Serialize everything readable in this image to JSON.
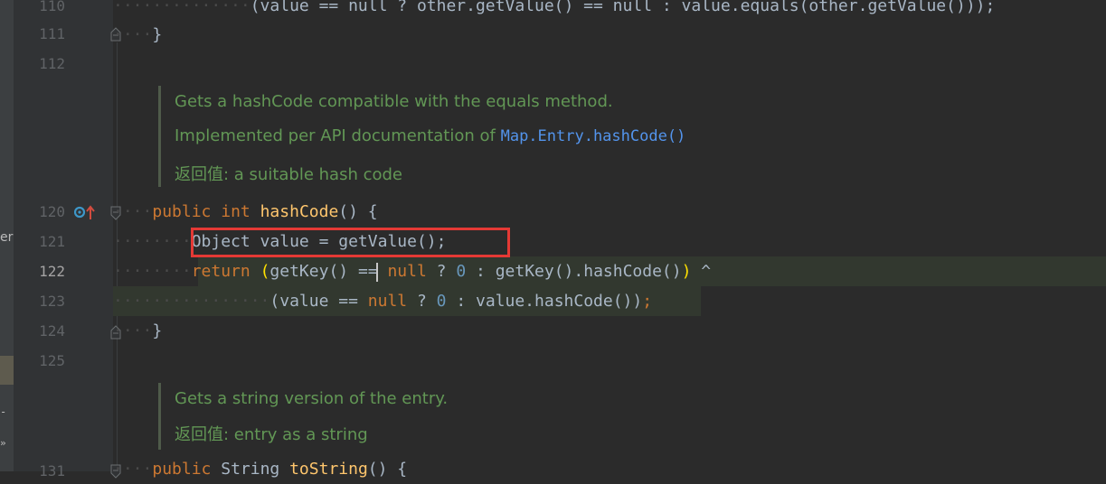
{
  "gutter": {
    "line_numbers": [
      "110",
      "111",
      "112",
      "120",
      "121",
      "122",
      "123",
      "124",
      "125",
      "131"
    ],
    "current_line": "122"
  },
  "side_panel": {
    "label_fragment": "er",
    "expand_glyph": "»"
  },
  "code": {
    "l110": {
      "indent": "··············",
      "text": "(value == null ? other.getValue() == null : value.equals(other.getValue()));"
    },
    "l111": {
      "indent": "····",
      "text": "}"
    },
    "l120": {
      "indent": "····",
      "kw1": "public",
      "kw2": "int",
      "fn": "hashCode",
      "rest": "() {"
    },
    "l121": {
      "indent": "········",
      "text": "Object value = getValue();"
    },
    "l122": {
      "indent": "········",
      "kw": "return",
      "open": "(",
      "p1": "getKey() == ",
      "null": "null",
      "p2": " ? ",
      "zero": "0",
      "p3": " : getKey().hashCode()",
      "close": ")",
      "op": " ^"
    },
    "l123": {
      "indent": "················",
      "p1": "(value == ",
      "null": "null",
      "p2": " ? ",
      "zero": "0",
      "p3": " : value.hashCode())",
      "semi": ";"
    },
    "l124": {
      "indent": "····",
      "text": "}"
    },
    "l131": {
      "indent": "····",
      "kw": "public",
      "p1": " String ",
      "fn": "toString",
      "rest": "() {"
    }
  },
  "doc1": {
    "line1": "Gets a hashCode compatible with the equals method.",
    "line2_prefix": "Implemented per API documentation of ",
    "line2_link": "Map.Entry.hashCode()",
    "line3": "返回值: a suitable hash code"
  },
  "doc2": {
    "line1": "Gets a string version of the entry.",
    "line2": "返回值: entry as a string"
  },
  "colors": {
    "background": "#2b2b2b",
    "keyword": "#cc7832",
    "method": "#ffc66d",
    "number": "#6897bb",
    "doc": "#629755",
    "highlight_box": "#e53935"
  }
}
